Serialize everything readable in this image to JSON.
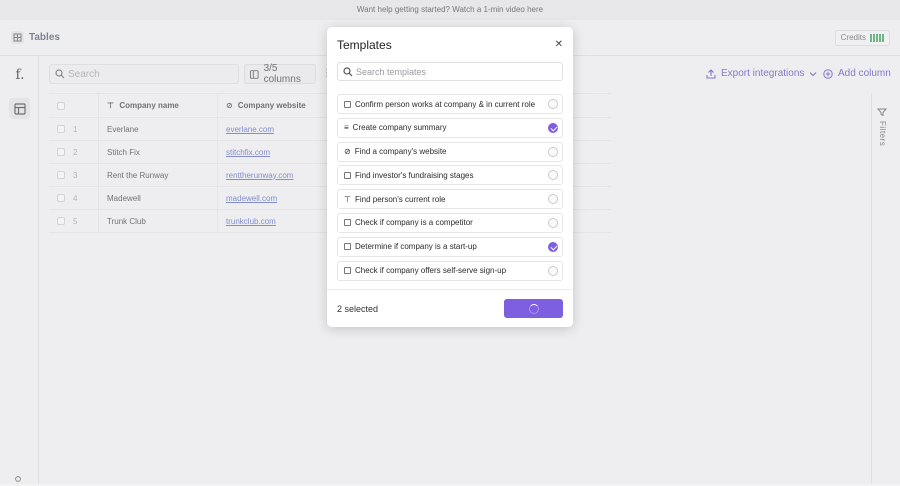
{
  "banner": {
    "text": "Want help getting started? Watch a 1-min video here"
  },
  "topbar": {
    "title": "Tables",
    "credits_label": "Credits"
  },
  "rail": {
    "logo": "f."
  },
  "toolbar": {
    "search_placeholder": "Search",
    "columns_label": "3/5 columns",
    "export_label": "Export integrations",
    "add_column_label": "Add column"
  },
  "grid": {
    "headers": {
      "name": "Company name",
      "website": "Company website"
    },
    "rows": [
      {
        "num": "1",
        "name": "Everlane",
        "website": "everlane.com"
      },
      {
        "num": "2",
        "name": "Stitch Fix",
        "website": "stitchfix.com"
      },
      {
        "num": "3",
        "name": "Rent the Runway",
        "website": "renttherunway.com"
      },
      {
        "num": "4",
        "name": "Madewell",
        "website": "madewell.com"
      },
      {
        "num": "5",
        "name": "Trunk Club",
        "website": "trunkclub.com"
      }
    ]
  },
  "filters": {
    "label": "Filters"
  },
  "modal": {
    "title": "Templates",
    "search_placeholder": "Search templates",
    "templates": [
      {
        "label": "Confirm person works at company & in current role",
        "selected": false
      },
      {
        "label": "Create company summary",
        "selected": true
      },
      {
        "label": "Find a company's website",
        "selected": false
      },
      {
        "label": "Find investor's fundraising stages",
        "selected": false
      },
      {
        "label": "Find person's current role",
        "selected": false
      },
      {
        "label": "Check if company is a competitor",
        "selected": false
      },
      {
        "label": "Determine if company is a start-up",
        "selected": true
      },
      {
        "label": "Check if company offers self-serve sign-up",
        "selected": false
      }
    ],
    "selected_count": "2 selected"
  },
  "colors": {
    "accent": "#7e5fe0",
    "link": "#4c5fbf",
    "accent_text": "#4d3fb8"
  }
}
